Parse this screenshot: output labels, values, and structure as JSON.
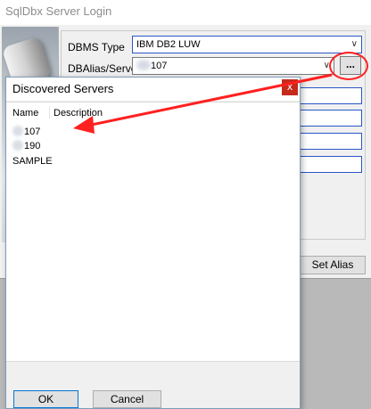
{
  "login": {
    "title": "SqlDbx Server Login",
    "dbms_label": "DBMS Type",
    "dbms_value": "IBM DB2 LUW",
    "dbalias_label": "DBAlias/Server",
    "dbalias_value": "107",
    "browse_button": "...",
    "set_alias_button": "Set Alias"
  },
  "dialog": {
    "title": "Discovered Servers",
    "close_label": "x",
    "columns": [
      "Name",
      "Description"
    ],
    "rows": [
      {
        "name": "107"
      },
      {
        "name": "190"
      },
      {
        "name": "SAMPLE"
      }
    ],
    "ok_button": "OK",
    "cancel_button": "Cancel"
  },
  "annotation": {
    "color": "#ff2020"
  }
}
